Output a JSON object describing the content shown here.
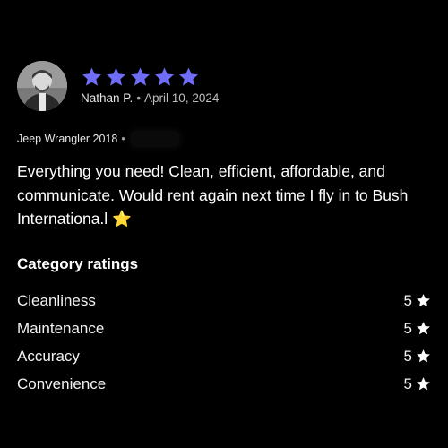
{
  "review": {
    "rating": 5,
    "rating_max": 5,
    "reviewer_name": "Nathan P.",
    "separator": "•",
    "date": "April 10, 2024",
    "vehicle": "Jeep Wrangler 2018",
    "vehicle_separator": "•",
    "text": "Everything you need! Clean, efficient, affordable, and communicate. Would rent again next time I fly in to Bush Internationa.l",
    "emoji": "⭐",
    "star_color": "#6f6cf7"
  },
  "category_ratings": {
    "title": "Category ratings",
    "items": [
      {
        "label": "Cleanliness",
        "score": "5",
        "icon": "star-icon"
      },
      {
        "label": "Maintenance",
        "score": "5",
        "icon": "star-icon"
      },
      {
        "label": "Accuracy",
        "score": "5",
        "icon": "star-icon"
      },
      {
        "label": "Convenience",
        "score": "5",
        "icon": "star-icon"
      }
    ]
  }
}
